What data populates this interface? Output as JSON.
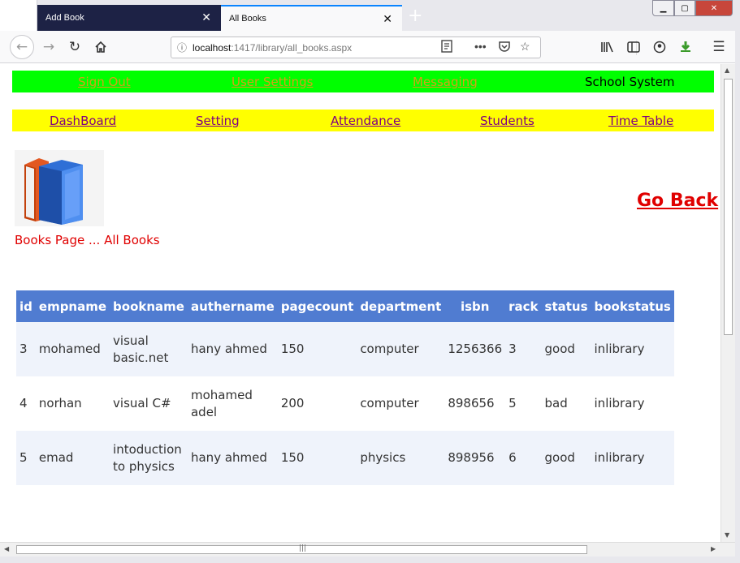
{
  "browser": {
    "tabs": [
      {
        "title": "Add Book",
        "active": false
      },
      {
        "title": "All Books",
        "active": true
      }
    ],
    "url": {
      "host": "localhost",
      "path": ":1417/library/all_books.aspx"
    }
  },
  "top_menu": {
    "links": [
      "Sign Out",
      "User Settings",
      "Messaging"
    ],
    "brand": "School System",
    "link_color": "#d4a017",
    "background": "#00ff00"
  },
  "main_menu": {
    "links": [
      "DashBoard",
      "Setting",
      "Attendance",
      "Students",
      "Time Table"
    ],
    "link_color": "#800080",
    "background": "#ffff00"
  },
  "page": {
    "caption": "Books Page ... All Books",
    "go_back": "Go Back",
    "accent": "#e00000"
  },
  "table": {
    "columns": [
      "id",
      "empname",
      "bookname",
      "authername",
      "pagecount",
      "department",
      "isbn",
      "rack",
      "status",
      "bookstatus"
    ],
    "rows": [
      {
        "id": "3",
        "empname": "mohamed",
        "bookname": "visual basic.net",
        "authername": "hany ahmed",
        "pagecount": "150",
        "department": "computer",
        "isbn": "1256366",
        "rack": "3",
        "status": "good",
        "bookstatus": "inlibrary"
      },
      {
        "id": "4",
        "empname": "norhan",
        "bookname": "visual C#",
        "authername": "mohamed adel",
        "pagecount": "200",
        "department": "computer",
        "isbn": "898656",
        "rack": "5",
        "status": "bad",
        "bookstatus": "inlibrary"
      },
      {
        "id": "5",
        "empname": "emad",
        "bookname": "intoduction to physics",
        "authername": "hany ahmed",
        "pagecount": "150",
        "department": "physics",
        "isbn": "898956",
        "rack": "6",
        "status": "good",
        "bookstatus": "inlibrary"
      }
    ],
    "header_color": "#507cd1",
    "alt_row_color": "#eff3fb"
  }
}
